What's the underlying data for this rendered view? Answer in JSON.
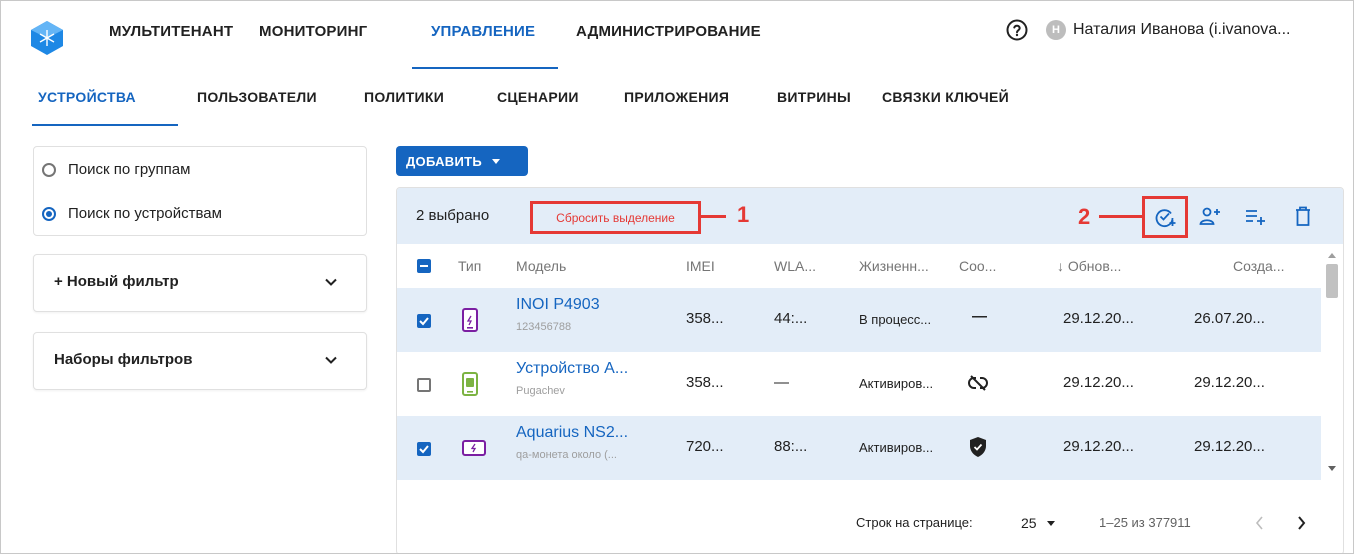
{
  "top_nav": {
    "items": [
      "МУЛЬТИТЕНАНТ",
      "МОНИТОРИНГ",
      "УПРАВЛЕНИЕ",
      "АДМИНИСТРИРОВАНИЕ"
    ],
    "active": "УПРАВЛЕНИЕ",
    "help_icon": "help-circle-icon",
    "avatar_letter": "Н",
    "user_name": "Наталия Иванова (i.ivanova..."
  },
  "sub_nav": {
    "tabs": [
      "УСТРОЙСТВА",
      "ПОЛЬЗОВАТЕЛИ",
      "ПОЛИТИКИ",
      "СЦЕНАРИИ",
      "ПРИЛОЖЕНИЯ",
      "ВИТРИНЫ",
      "СВЯЗКИ КЛЮЧЕЙ"
    ],
    "active": "УСТРОЙСТВА"
  },
  "search_mode": {
    "options": [
      "Поиск по группам",
      "Поиск по устройствам"
    ],
    "selected": "Поиск по устройствам"
  },
  "filters": {
    "new_filter": "+ Новый фильтр",
    "filter_sets": "Наборы фильтров"
  },
  "toolbar": {
    "add_label": "ДОБАВИТЬ"
  },
  "selection": {
    "count_text": "2 выбрано",
    "reset_label": "Сбросить выделение",
    "annotation_1": "1",
    "annotation_2": "2",
    "actions": [
      "check-circle-plus-icon",
      "add-user-icon",
      "add-to-list-icon",
      "delete-icon"
    ]
  },
  "table": {
    "columns": [
      "Тип",
      "Модель",
      "IMEI",
      "WLA...",
      "Жизненн...",
      "Соо...",
      "↓ Обнов...",
      "Созда..."
    ],
    "rows": [
      {
        "selected": true,
        "model": "INOI P4903",
        "sub": "123456788",
        "imei": "358...",
        "wlan": "44:...",
        "life": "В процесс...",
        "status": "—",
        "updated": "29.12.20...",
        "created": "26.07.20..."
      },
      {
        "selected": false,
        "model": "Устройство А...",
        "sub": "Pugachev",
        "imei": "358...",
        "wlan": "—",
        "life": "Активиров...",
        "status": "",
        "updated": "29.12.20...",
        "created": "29.12.20..."
      },
      {
        "selected": true,
        "model": "Aquarius NS2...",
        "sub": "qa-монета около (...",
        "imei": "720...",
        "wlan": "88:...",
        "life": "Активиров...",
        "status": "",
        "updated": "29.12.20...",
        "created": "29.12.20..."
      }
    ]
  },
  "pagination": {
    "rows_per_page_label": "Строк на странице:",
    "rows_per_page": "25",
    "range": "1–25 из 377911"
  },
  "colors": {
    "accent": "#1565c0",
    "annotation": "#e53935",
    "selected_bg": "#e3edf8"
  }
}
